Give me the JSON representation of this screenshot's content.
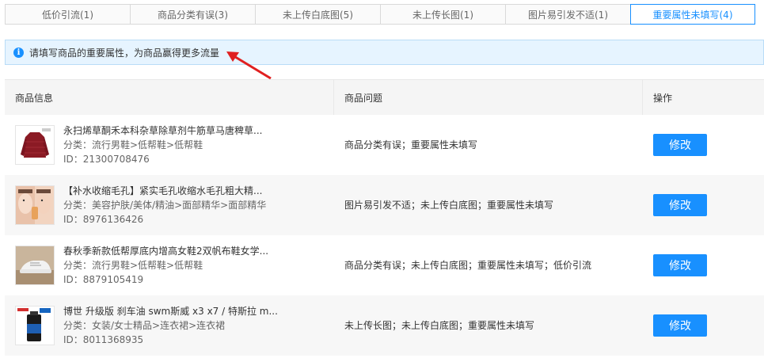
{
  "tabs": [
    {
      "label": "低价引流(1)"
    },
    {
      "label": "商品分类有误(3)"
    },
    {
      "label": "未上传白底图(5)"
    },
    {
      "label": "未上传长图(1)"
    },
    {
      "label": "图片易引发不适(1)"
    },
    {
      "label": "重要属性未填写(4)",
      "active": true
    }
  ],
  "notice": {
    "icon": "info-icon",
    "text": "请填写商品的重要属性，为商品赢得更多流量"
  },
  "table": {
    "headers": {
      "info": "商品信息",
      "issue": "商品问题",
      "action": "操作"
    },
    "rows": [
      {
        "name": "永扫烯草酮禾本科杂草除草剂牛筋草马唐稗草...",
        "category": "分类：流行男鞋>低帮鞋>低帮鞋",
        "id": "ID：21300708476",
        "issue": "商品分类有误；重要属性未填写",
        "action": "修改",
        "thumb": "jacket"
      },
      {
        "name": "【补水收缩毛孔】紧实毛孔收缩水毛孔粗大精...",
        "category": "分类：美容护肤/美体/精油>面部精华>面部精华",
        "id": "ID：8976136426",
        "issue": "图片易引发不适；未上传白底图；重要属性未填写",
        "action": "修改",
        "thumb": "faces"
      },
      {
        "name": "春秋季新款低帮厚底内增高女鞋2双帆布鞋女学...",
        "category": "分类：流行男鞋>低帮鞋>低帮鞋",
        "id": "ID：8879105419",
        "issue": "商品分类有误；未上传白底图；重要属性未填写；低价引流",
        "action": "修改",
        "thumb": "shoe"
      },
      {
        "name": "博世 升级版 刹车油 swm斯威 x3 x7 / 特斯拉 m...",
        "category": "分类：女装/女士精品>连衣裙>连衣裙",
        "id": "ID：8011368935",
        "issue": "未上传长图；未上传白底图；重要属性未填写",
        "action": "修改",
        "thumb": "bottle"
      }
    ]
  },
  "colors": {
    "accent": "#1890ff",
    "notice_bg": "#e6f4ff",
    "arrow": "#e02020"
  }
}
